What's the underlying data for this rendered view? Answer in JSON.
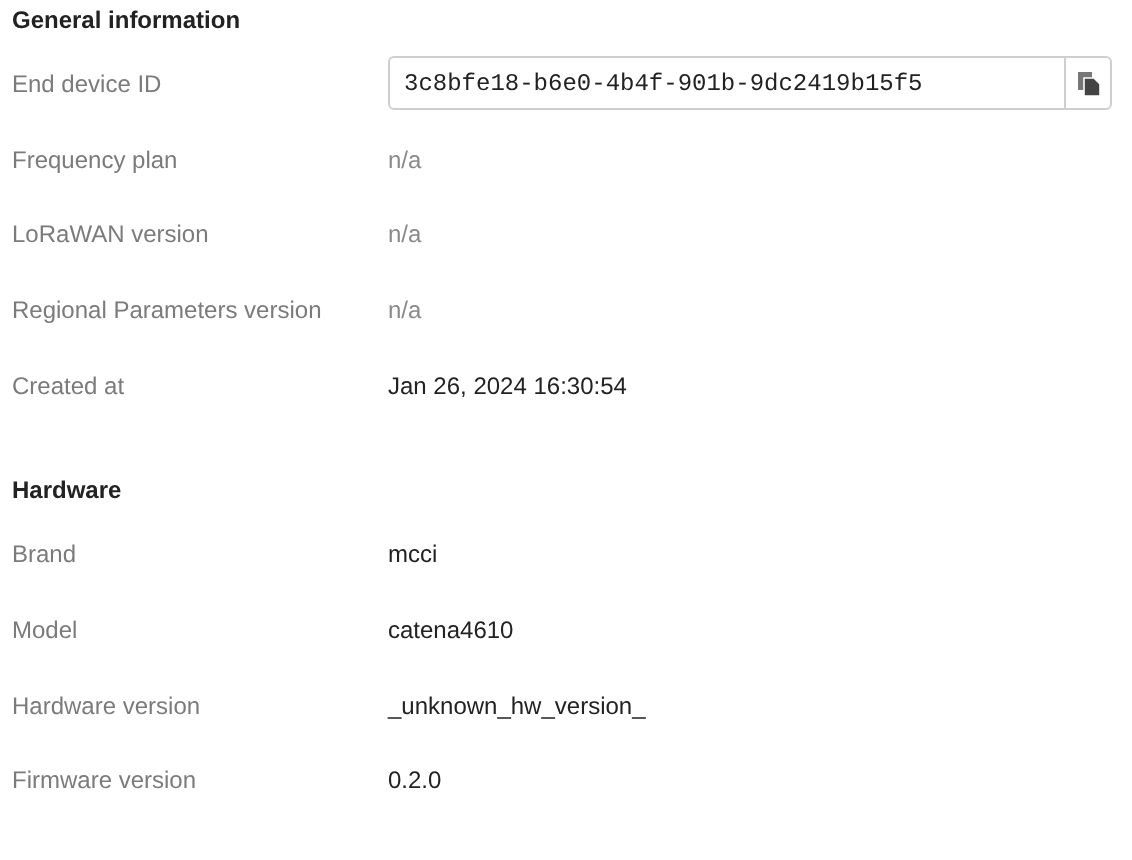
{
  "sections": [
    {
      "title": "General information",
      "rows": [
        {
          "label": "End device ID",
          "kind": "copy-field",
          "value": "3c8bfe18-b6e0-4b4f-901b-9dc2419b15f5"
        },
        {
          "label": "Frequency plan",
          "kind": "unset",
          "value": "n/a"
        },
        {
          "label": "LoRaWAN version",
          "kind": "unset",
          "value": "n/a"
        },
        {
          "label": "Regional Parameters version",
          "kind": "unset",
          "value": "n/a"
        },
        {
          "label": "Created at",
          "kind": "text",
          "value": "Jan 26, 2024 16:30:54"
        }
      ]
    },
    {
      "title": "Hardware",
      "rows": [
        {
          "label": "Brand",
          "kind": "text",
          "value": "mcci"
        },
        {
          "label": "Model",
          "kind": "text",
          "value": "catena4610"
        },
        {
          "label": "Hardware version",
          "kind": "text",
          "value": "_unknown_hw_version_"
        },
        {
          "label": "Firmware version",
          "kind": "text",
          "value": "0.2.0"
        }
      ]
    }
  ]
}
